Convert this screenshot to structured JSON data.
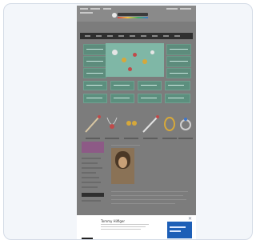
{
  "screenshot": {
    "description": "Thumbnail of a jewelry e-commerce web page shown inside a rounded panel, dimmed by a dark overlay, with a white advertisement bar at the bottom",
    "ad": {
      "title": "Tommy Hilfiger",
      "close_icon": "✕"
    },
    "colors": {
      "overlay": "#7c7c7c",
      "accent_teal": "#5d8c7c",
      "ad_blue": "#1d5fb7"
    }
  }
}
